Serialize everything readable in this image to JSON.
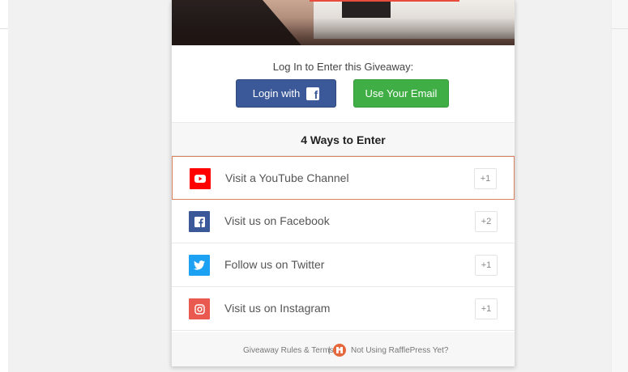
{
  "login": {
    "title": "Log In to Enter this Giveaway:",
    "facebook_button": "Login with",
    "email_button": "Use Your Email"
  },
  "ways": {
    "title": "4 Ways to Enter",
    "entries": [
      {
        "label": "Visit a YouTube Channel",
        "points": "+1",
        "icon": "youtube-icon",
        "color": "#ff0000"
      },
      {
        "label": "Visit us on Facebook",
        "points": "+2",
        "icon": "facebook-icon",
        "color": "#3b5998"
      },
      {
        "label": "Follow us on Twitter",
        "points": "+1",
        "icon": "twitter-icon",
        "color": "#1da1f2"
      },
      {
        "label": "Visit us on Instagram",
        "points": "+1",
        "icon": "instagram-icon",
        "color": "#e95950"
      }
    ]
  },
  "footer": {
    "rules": "Giveaway Rules & Terms",
    "separator": "|",
    "not_using": "Not Using RafflePress Yet?"
  }
}
